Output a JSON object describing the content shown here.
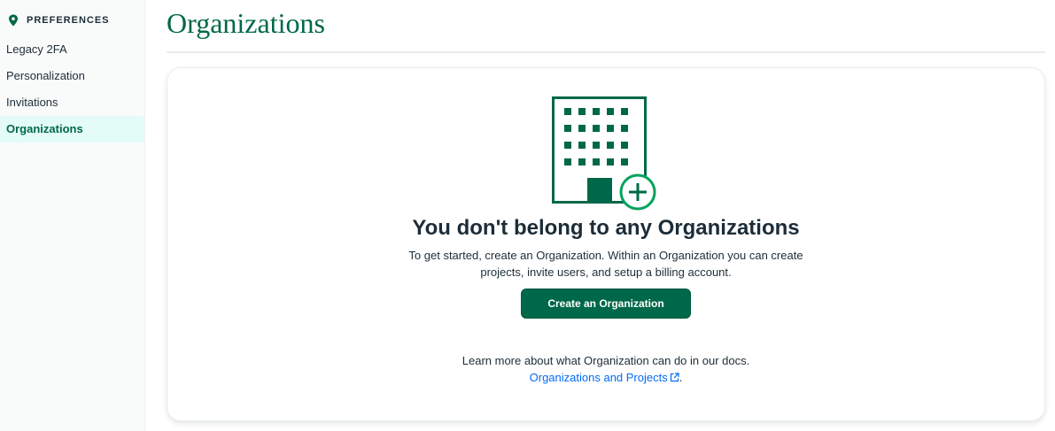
{
  "sidebar": {
    "heading": "PREFERENCES",
    "heading_icon": "location-pin-icon",
    "items": [
      {
        "label": "Legacy 2FA",
        "active": false
      },
      {
        "label": "Personalization",
        "active": false
      },
      {
        "label": "Invitations",
        "active": false
      },
      {
        "label": "Organizations",
        "active": true
      }
    ]
  },
  "main": {
    "title": "Organizations",
    "empty_state": {
      "illustration": "building-add-icon",
      "heading": "You don't belong to any Organizations",
      "description_line1": "To get started, create an Organization. Within an Organization you can create",
      "description_line2": "projects, invite users, and setup a billing account.",
      "create_button_label": "Create an Organization",
      "learn_more_text": "Learn more about what Organization can do in our docs.",
      "docs_link_label": "Organizations and Projects",
      "docs_link_icon": "external-link-icon",
      "docs_link_suffix": "."
    }
  },
  "colors": {
    "brand_green": "#00684a",
    "active_bg": "#e3fcf7",
    "link_blue": "#016bf8",
    "text_dark": "#1c2d38"
  }
}
